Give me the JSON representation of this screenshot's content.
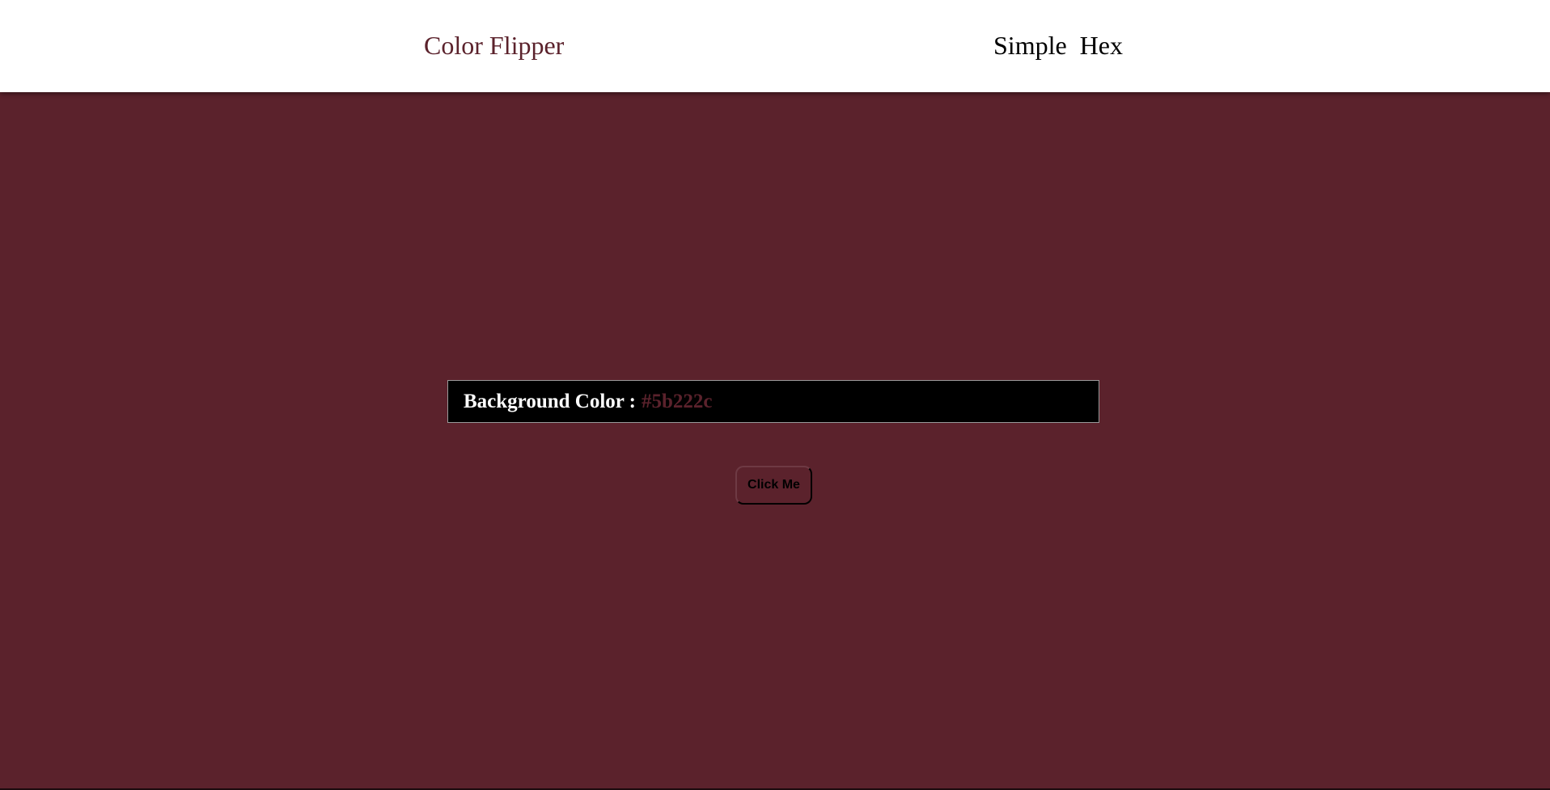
{
  "page": {
    "background_color": "#5b222c"
  },
  "navbar": {
    "brand": "Color Flipper",
    "brand_color": "#5b222c",
    "links": [
      {
        "label": "Simple"
      },
      {
        "label": "Hex"
      }
    ]
  },
  "color_display": {
    "label": "Background Color :",
    "value": "#5b222c"
  },
  "action": {
    "button_label": "Click Me"
  }
}
